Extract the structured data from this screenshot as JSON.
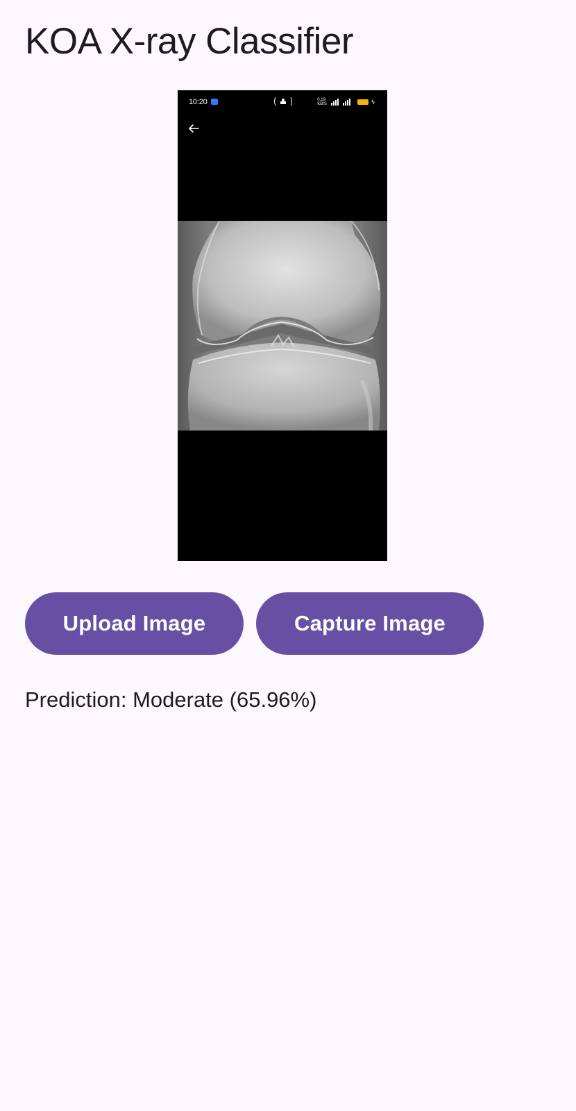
{
  "app": {
    "title": "KOA X-ray Classifier"
  },
  "preview": {
    "status_bar": {
      "time": "10:20",
      "speed_line1": "0.19",
      "speed_line2": "KB/S"
    },
    "icons": {
      "back": "arrow-left-icon",
      "app_notification": "app-notification-icon",
      "signal": "signal-icon",
      "battery": "battery-icon",
      "charging": "bolt-icon"
    }
  },
  "actions": {
    "upload_label": "Upload Image",
    "capture_label": "Capture Image"
  },
  "result": {
    "prediction_text": "Prediction: Moderate (65.96%)"
  },
  "colors": {
    "background": "#fdf7fe",
    "button": "#6750a4",
    "button_text": "#ffffff",
    "text": "#1d1b20"
  }
}
